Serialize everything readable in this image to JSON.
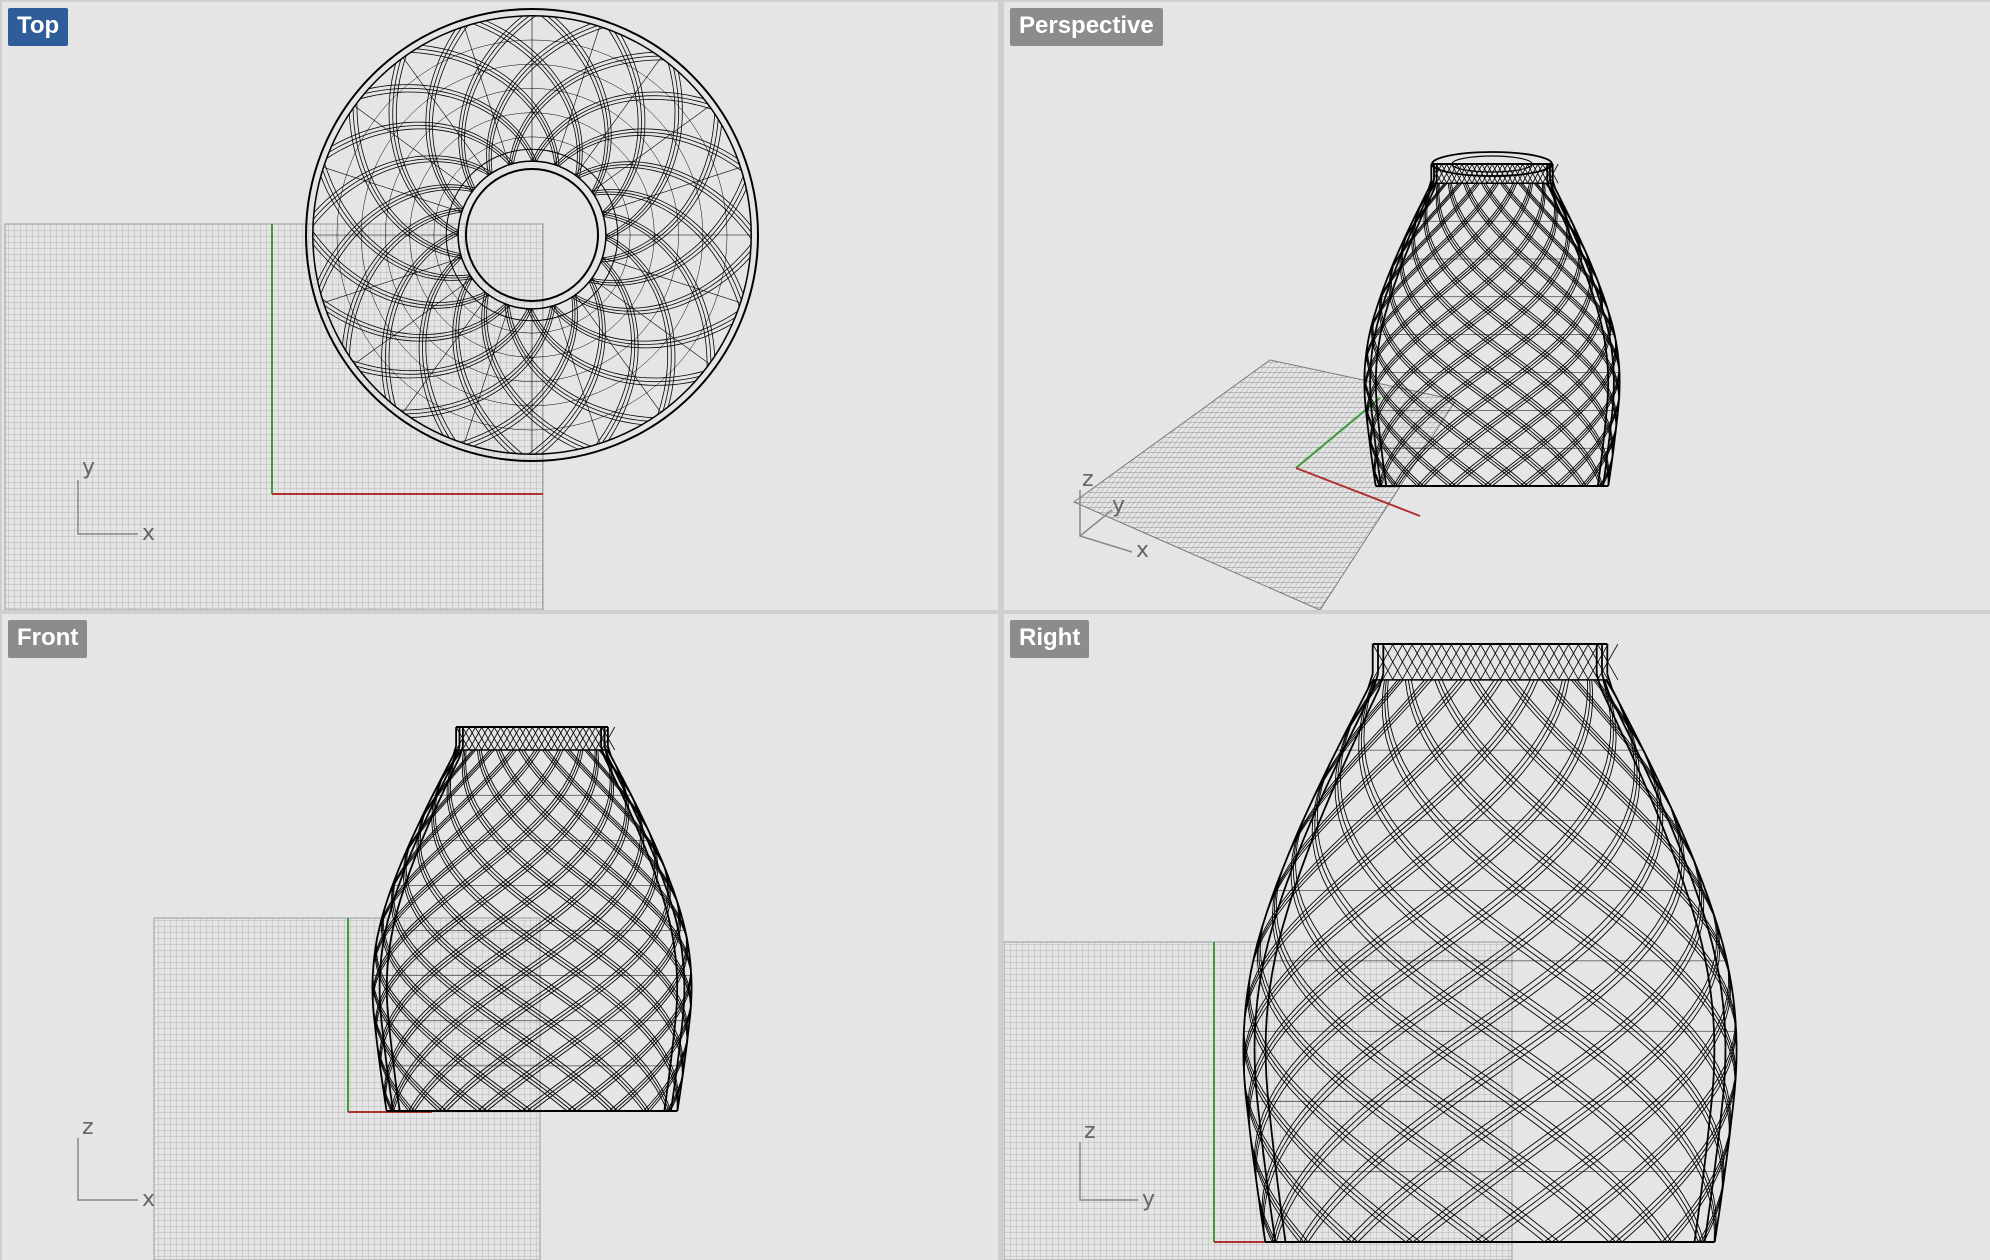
{
  "viewports": {
    "top": {
      "label": "Top",
      "active": true,
      "axes": [
        "y",
        "x"
      ]
    },
    "perspective": {
      "label": "Perspective",
      "active": false,
      "axes": [
        "z",
        "y",
        "x"
      ]
    },
    "front": {
      "label": "Front",
      "active": false,
      "axes": [
        "z",
        "x"
      ]
    },
    "right": {
      "label": "Right",
      "active": false,
      "axes": [
        "z",
        "y"
      ]
    }
  },
  "colors": {
    "viewport_bg": "#e5e5e5",
    "grid": "#9a9a9a",
    "wire": "#000000",
    "x_axis": "#b03030",
    "y_axis": "#3c9a3c",
    "active_label": "#2f5d9a",
    "label": "#8c8c8c"
  }
}
